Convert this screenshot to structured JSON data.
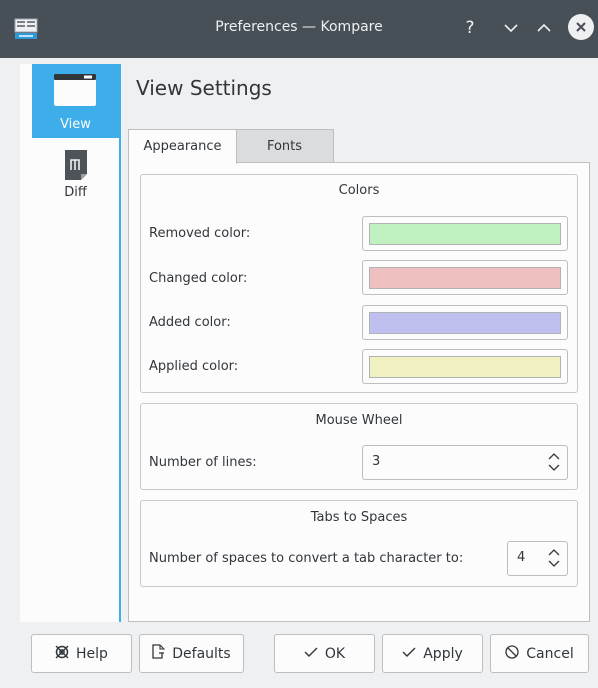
{
  "window": {
    "title": "Preferences — Kompare"
  },
  "titlebar_buttons": {
    "help": "?"
  },
  "sidebar": {
    "items": [
      {
        "label": "View",
        "icon": "view-window-icon",
        "selected": true
      },
      {
        "label": "Diff",
        "icon": "diff-document-icon",
        "selected": false
      }
    ]
  },
  "page": {
    "heading": "View Settings"
  },
  "tabs": [
    {
      "label": "Appearance",
      "active": true
    },
    {
      "label": "Fonts",
      "active": false
    }
  ],
  "colors": {
    "title": "Colors",
    "removed": {
      "label": "Removed color:",
      "color": "#c0f0c0"
    },
    "changed": {
      "label": "Changed color:",
      "color": "#f0c0c0"
    },
    "added": {
      "label": "Added color:",
      "color": "#c0c0f0"
    },
    "applied": {
      "label": "Applied color:",
      "color": "#f0f0c0"
    }
  },
  "mouse_wheel": {
    "title": "Mouse Wheel",
    "label": "Number of lines:",
    "value": "3"
  },
  "tabs_to_spaces": {
    "title": "Tabs to Spaces",
    "label": "Number of spaces to convert a tab character to:",
    "value": "4"
  },
  "buttons": {
    "help": "Help",
    "defaults": "Defaults",
    "ok": "OK",
    "apply": "Apply",
    "cancel": "Cancel"
  },
  "accent": "#3daee9"
}
